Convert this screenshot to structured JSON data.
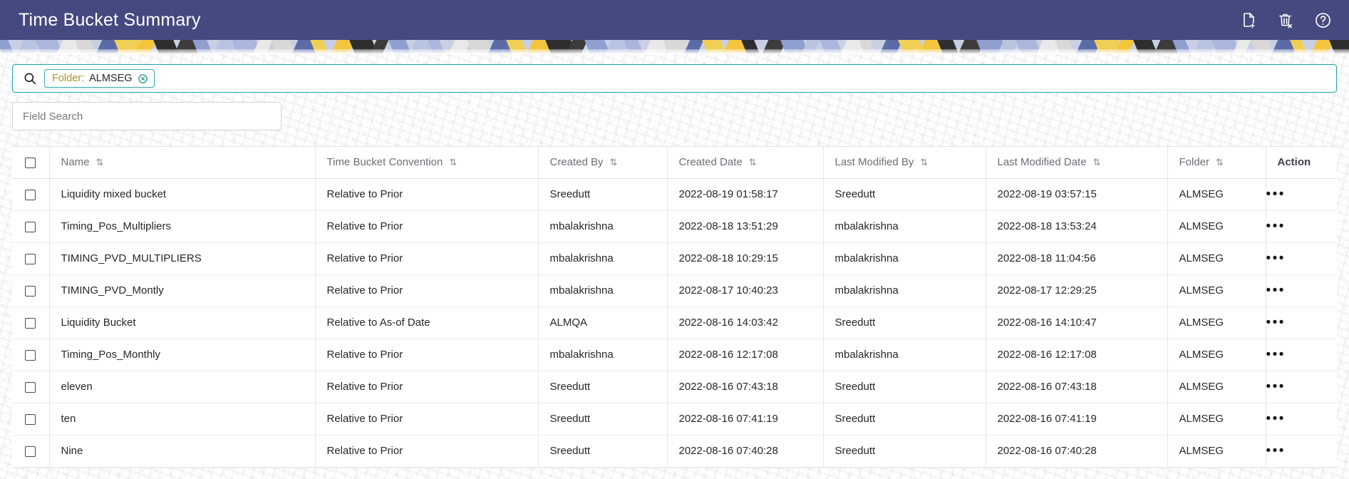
{
  "appbar": {
    "title": "Time Bucket Summary",
    "background_color": "#44497f",
    "actions": [
      {
        "name": "add-document-icon",
        "label": "New"
      },
      {
        "name": "delete-icon",
        "label": "Delete"
      },
      {
        "name": "help-icon",
        "label": "Help"
      }
    ]
  },
  "search": {
    "icon": "search-icon",
    "chip": {
      "key": "Folder:",
      "value": "ALMSEG",
      "close_label": "⊗"
    },
    "border_color": "#1ba3a9"
  },
  "field_search": {
    "placeholder": "Field Search",
    "value": ""
  },
  "table": {
    "columns": [
      {
        "key": "check",
        "label": "",
        "sortable": false
      },
      {
        "key": "name",
        "label": "Name",
        "sortable": true
      },
      {
        "key": "conv",
        "label": "Time Bucket Convention",
        "sortable": true
      },
      {
        "key": "cby",
        "label": "Created By",
        "sortable": true
      },
      {
        "key": "cdate",
        "label": "Created Date",
        "sortable": true
      },
      {
        "key": "lmby",
        "label": "Last Modified By",
        "sortable": true
      },
      {
        "key": "lmdate",
        "label": "Last Modified Date",
        "sortable": true
      },
      {
        "key": "folder",
        "label": "Folder",
        "sortable": true
      },
      {
        "key": "action",
        "label": "Action",
        "sortable": false
      }
    ],
    "sort_glyph": "⇅",
    "action_glyph": "•••",
    "rows": [
      {
        "name": "Liquidity mixed bucket",
        "conv": "Relative to Prior",
        "cby": "Sreedutt",
        "cdate": "2022-08-19 01:58:17",
        "lmby": "Sreedutt",
        "lmdate": "2022-08-19 03:57:15",
        "folder": "ALMSEG",
        "checked": false
      },
      {
        "name": "Timing_Pos_Multipliers",
        "conv": "Relative to Prior",
        "cby": "mbalakrishna",
        "cdate": "2022-08-18 13:51:29",
        "lmby": "mbalakrishna",
        "lmdate": "2022-08-18 13:53:24",
        "folder": "ALMSEG",
        "checked": false
      },
      {
        "name": "TIMING_PVD_MULTIPLIERS",
        "conv": "Relative to Prior",
        "cby": "mbalakrishna",
        "cdate": "2022-08-18 10:29:15",
        "lmby": "mbalakrishna",
        "lmdate": "2022-08-18 11:04:56",
        "folder": "ALMSEG",
        "checked": false
      },
      {
        "name": "TIMING_PVD_Montly",
        "conv": "Relative to Prior",
        "cby": "mbalakrishna",
        "cdate": "2022-08-17 10:40:23",
        "lmby": "mbalakrishna",
        "lmdate": "2022-08-17 12:29:25",
        "folder": "ALMSEG",
        "checked": false
      },
      {
        "name": "Liquidity Bucket",
        "conv": "Relative to As-of Date",
        "cby": "ALMQA",
        "cdate": "2022-08-16 14:03:42",
        "lmby": "Sreedutt",
        "lmdate": "2022-08-16 14:10:47",
        "folder": "ALMSEG",
        "checked": false
      },
      {
        "name": "Timing_Pos_Monthly",
        "conv": "Relative to Prior",
        "cby": "mbalakrishna",
        "cdate": "2022-08-16 12:17:08",
        "lmby": "mbalakrishna",
        "lmdate": "2022-08-16 12:17:08",
        "folder": "ALMSEG",
        "checked": false
      },
      {
        "name": "eleven",
        "conv": "Relative to Prior",
        "cby": "Sreedutt",
        "cdate": "2022-08-16 07:43:18",
        "lmby": "Sreedutt",
        "lmdate": "2022-08-16 07:43:18",
        "folder": "ALMSEG",
        "checked": false
      },
      {
        "name": "ten",
        "conv": "Relative to Prior",
        "cby": "Sreedutt",
        "cdate": "2022-08-16 07:41:19",
        "lmby": "Sreedutt",
        "lmdate": "2022-08-16 07:41:19",
        "folder": "ALMSEG",
        "checked": false
      },
      {
        "name": "Nine",
        "conv": "Relative to Prior",
        "cby": "Sreedutt",
        "cdate": "2022-08-16 07:40:28",
        "lmby": "Sreedutt",
        "lmdate": "2022-08-16 07:40:28",
        "folder": "ALMSEG",
        "checked": false
      }
    ]
  }
}
